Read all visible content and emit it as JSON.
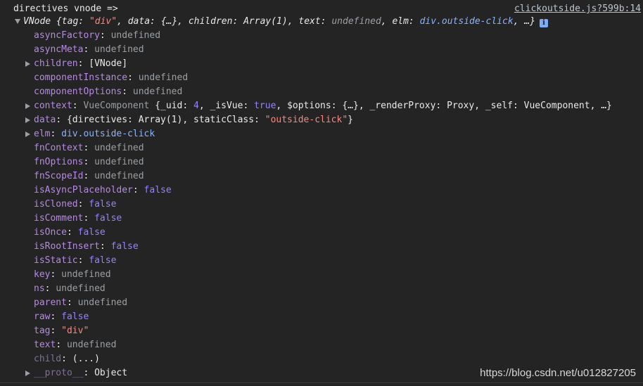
{
  "log": {
    "message": "directives vnode =>",
    "source_link": "clickoutside.js?599b:14"
  },
  "summary": {
    "label": "VNode",
    "p1": " {tag: ",
    "tag_val": "\"div\"",
    "p2": ", data: {…}, children: ",
    "children_val": "Array(1)",
    "p3": ", text: ",
    "text_val": "undefined",
    "p4": ", elm: ",
    "elm_val": "div.outside-click",
    "p5": ", …}",
    "info_glyph": "i"
  },
  "properties": [
    {
      "key": "asyncFactory",
      "sep": ": ",
      "value": "undefined"
    },
    {
      "key": "asyncMeta",
      "sep": ": ",
      "value": "undefined"
    },
    {
      "key": "children",
      "sep": ": ",
      "value": "[VNode]"
    },
    {
      "key": "componentInstance",
      "sep": ": ",
      "value": "undefined"
    },
    {
      "key": "componentOptions",
      "sep": ": ",
      "value": "undefined"
    },
    {
      "key": "context",
      "sep": ": ",
      "v1": "VueComponent ",
      "v2": "{_uid: ",
      "v3": "4",
      "v4": ", _isVue: ",
      "v5": "true",
      "v6": ", $options: {…}, _renderProxy: ",
      "v7": "Proxy",
      "v8": ", _self: ",
      "v9": "VueComponent",
      "v10": ", …}"
    },
    {
      "key": "data",
      "sep": ": ",
      "v1": "{directives: ",
      "v2": "Array(1)",
      "v3": ", staticClass: ",
      "v4": "\"outside-click\"",
      "v5": "}"
    },
    {
      "key": "elm",
      "sep": ": ",
      "value": "div.outside-click"
    },
    {
      "key": "fnContext",
      "sep": ": ",
      "value": "undefined"
    },
    {
      "key": "fnOptions",
      "sep": ": ",
      "value": "undefined"
    },
    {
      "key": "fnScopeId",
      "sep": ": ",
      "value": "undefined"
    },
    {
      "key": "isAsyncPlaceholder",
      "sep": ": ",
      "value": "false"
    },
    {
      "key": "isCloned",
      "sep": ": ",
      "value": "false"
    },
    {
      "key": "isComment",
      "sep": ": ",
      "value": "false"
    },
    {
      "key": "isOnce",
      "sep": ": ",
      "value": "false"
    },
    {
      "key": "isRootInsert",
      "sep": ": ",
      "value": "false"
    },
    {
      "key": "isStatic",
      "sep": ": ",
      "value": "false"
    },
    {
      "key": "key",
      "sep": ": ",
      "value": "undefined"
    },
    {
      "key": "ns",
      "sep": ": ",
      "value": "undefined"
    },
    {
      "key": "parent",
      "sep": ": ",
      "value": "undefined"
    },
    {
      "key": "raw",
      "sep": ": ",
      "value": "false"
    },
    {
      "key": "tag",
      "sep": ": ",
      "value": "\"div\""
    },
    {
      "key": "text",
      "sep": ": ",
      "value": "undefined"
    },
    {
      "key": "child",
      "sep": ": ",
      "value": "(...)"
    },
    {
      "key": "__proto__",
      "sep": ": ",
      "value": "Object"
    }
  ],
  "watermark": "https://blog.csdn.net/u012827205"
}
